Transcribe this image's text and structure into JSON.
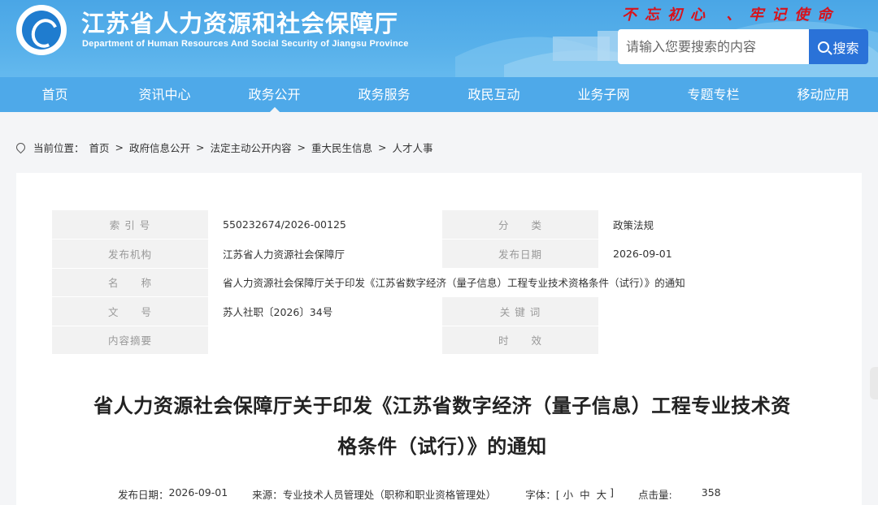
{
  "header": {
    "title": "江苏省人力资源和社会保障厅",
    "subtitle": "Department of Human Resources And Social Security of Jiangsu Province",
    "slogan": "不忘初心 、牢记使命",
    "search": {
      "placeholder": "请输入您要搜索的内容",
      "button_label": "搜索"
    }
  },
  "nav": {
    "items": [
      {
        "label": "首页"
      },
      {
        "label": "资讯中心"
      },
      {
        "label": "政务公开"
      },
      {
        "label": "政务服务"
      },
      {
        "label": "政民互动"
      },
      {
        "label": "业务子网"
      },
      {
        "label": "专题专栏"
      },
      {
        "label": "移动应用"
      }
    ]
  },
  "breadcrumb": {
    "prefix": "当前位置：",
    "items": [
      "首页",
      "政府信息公开",
      "法定主动公开内容",
      "重大民生信息",
      "人才人事"
    ],
    "separator": ">"
  },
  "info": {
    "rows": [
      {
        "l1": "索 引 号",
        "v1": "550232674/2026-00125",
        "l2": "分　　类",
        "v2": "政策法规"
      },
      {
        "l1": "发布机构",
        "v1": "江苏省人力资源社会保障厅",
        "l2": "发布日期",
        "v2": "2026-09-01"
      },
      {
        "l1": "名　　称",
        "v1": "省人力资源社会保障厅关于印发《江苏省数字经济（量子信息）工程专业技术资格条件（试行）》的通知"
      },
      {
        "l1": "文　　号",
        "v1": "苏人社职〔2026〕34号",
        "l2": "关 键 词",
        "v2": ""
      },
      {
        "l1": "内容摘要",
        "v1": "",
        "l2": "时　　效",
        "v2": ""
      }
    ]
  },
  "article": {
    "title_line1": "省人力资源社会保障厅关于印发《江苏省数字经济（量子信息）工程专业技术资",
    "title_line2": "格条件（试行）》的通知",
    "date_label": "发布日期：",
    "date": "2026-09-01",
    "source_label": "来源：",
    "source": "专业技术人员管理处（职称和职业资格管理处）",
    "font_label": "字体：[",
    "font_small": "小",
    "font_medium": "中",
    "font_large": "大",
    "font_end": "]",
    "clicks_label": "点击量:",
    "clicks": "358"
  },
  "colors": {
    "header_blue": "#4aa6e6",
    "search_button": "#2a72d8",
    "slogan_red": "#d8121b"
  }
}
